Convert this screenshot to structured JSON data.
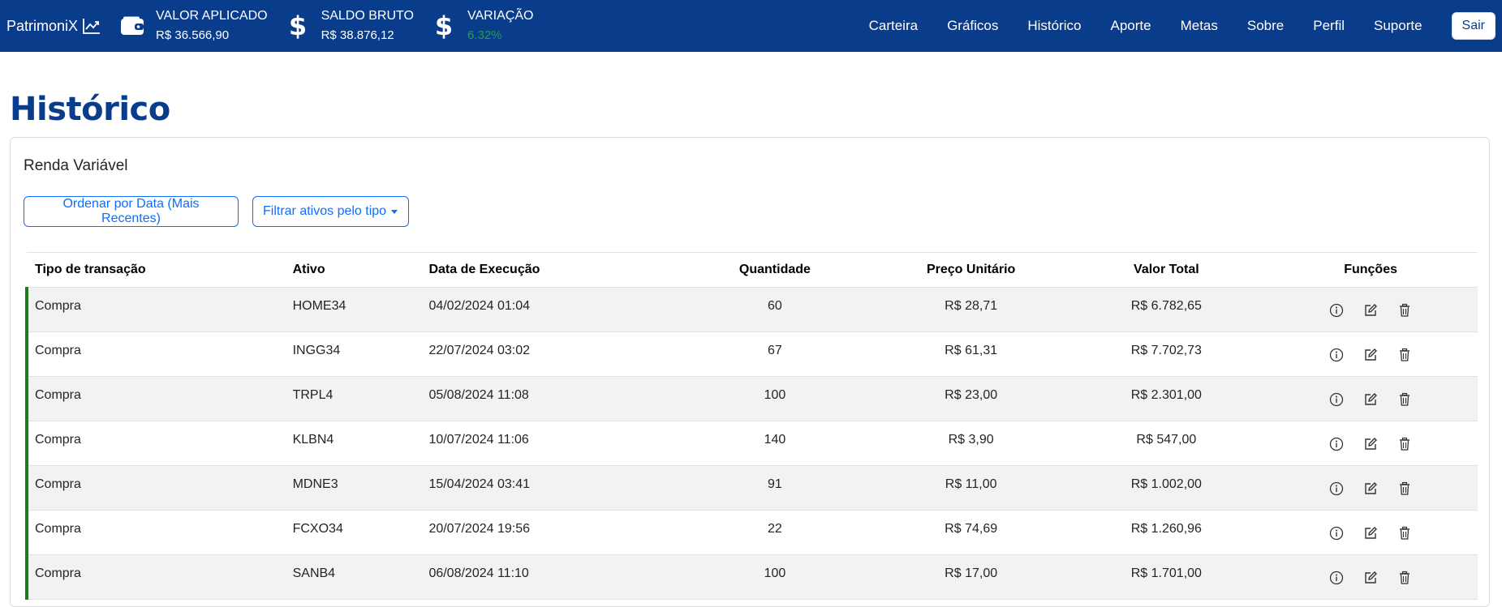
{
  "header": {
    "brand": "PatrimoniX",
    "stats": [
      {
        "label": "VALOR APLICADO",
        "value": "R$ 36.566,90",
        "icon": "wallet-icon"
      },
      {
        "label": "SALDO BRUTO",
        "value": "R$ 38.876,12",
        "icon": "dollar-icon"
      },
      {
        "label": "VARIAÇÃO",
        "value": "6.32%",
        "icon": "dollar-icon",
        "value_color": "#22a049"
      }
    ],
    "nav": [
      "Carteira",
      "Gráficos",
      "Histórico",
      "Aporte",
      "Metas",
      "Sobre",
      "Perfil",
      "Suporte"
    ],
    "logout": "Sair"
  },
  "page": {
    "title": "Histórico"
  },
  "card": {
    "title": "Renda Variável",
    "order_button": "Ordenar por Data (Mais Recentes)",
    "filter_button": "Filtrar ativos pelo tipo"
  },
  "table": {
    "columns": [
      "Tipo de transação",
      "Ativo",
      "Data de Execução",
      "Quantidade",
      "Preço Unitário",
      "Valor Total",
      "Funções"
    ],
    "rows": [
      {
        "tipo": "Compra",
        "ativo": "HOME34",
        "data": "04/02/2024 01:04",
        "quantidade": "60",
        "preco": "R$ 28,71",
        "total": "R$ 6.782,65"
      },
      {
        "tipo": "Compra",
        "ativo": "INGG34",
        "data": "22/07/2024 03:02",
        "quantidade": "67",
        "preco": "R$ 61,31",
        "total": "R$ 7.702,73"
      },
      {
        "tipo": "Compra",
        "ativo": "TRPL4",
        "data": "05/08/2024 11:08",
        "quantidade": "100",
        "preco": "R$ 23,00",
        "total": "R$ 2.301,00"
      },
      {
        "tipo": "Compra",
        "ativo": "KLBN4",
        "data": "10/07/2024 11:06",
        "quantidade": "140",
        "preco": "R$ 3,90",
        "total": "R$ 547,00"
      },
      {
        "tipo": "Compra",
        "ativo": "MDNE3",
        "data": "15/04/2024 03:41",
        "quantidade": "91",
        "preco": "R$ 11,00",
        "total": "R$ 1.002,00"
      },
      {
        "tipo": "Compra",
        "ativo": "FCXO34",
        "data": "20/07/2024 19:56",
        "quantidade": "22",
        "preco": "R$ 74,69",
        "total": "R$ 1.260,96"
      },
      {
        "tipo": "Compra",
        "ativo": "SANB4",
        "data": "06/08/2024 11:10",
        "quantidade": "100",
        "preco": "R$ 17,00",
        "total": "R$ 1.701,00"
      }
    ]
  },
  "colors": {
    "brand": "#0a3c8c",
    "accent": "#0d6efd",
    "positive": "#22a049",
    "row_marker": "#1f7a1f"
  }
}
